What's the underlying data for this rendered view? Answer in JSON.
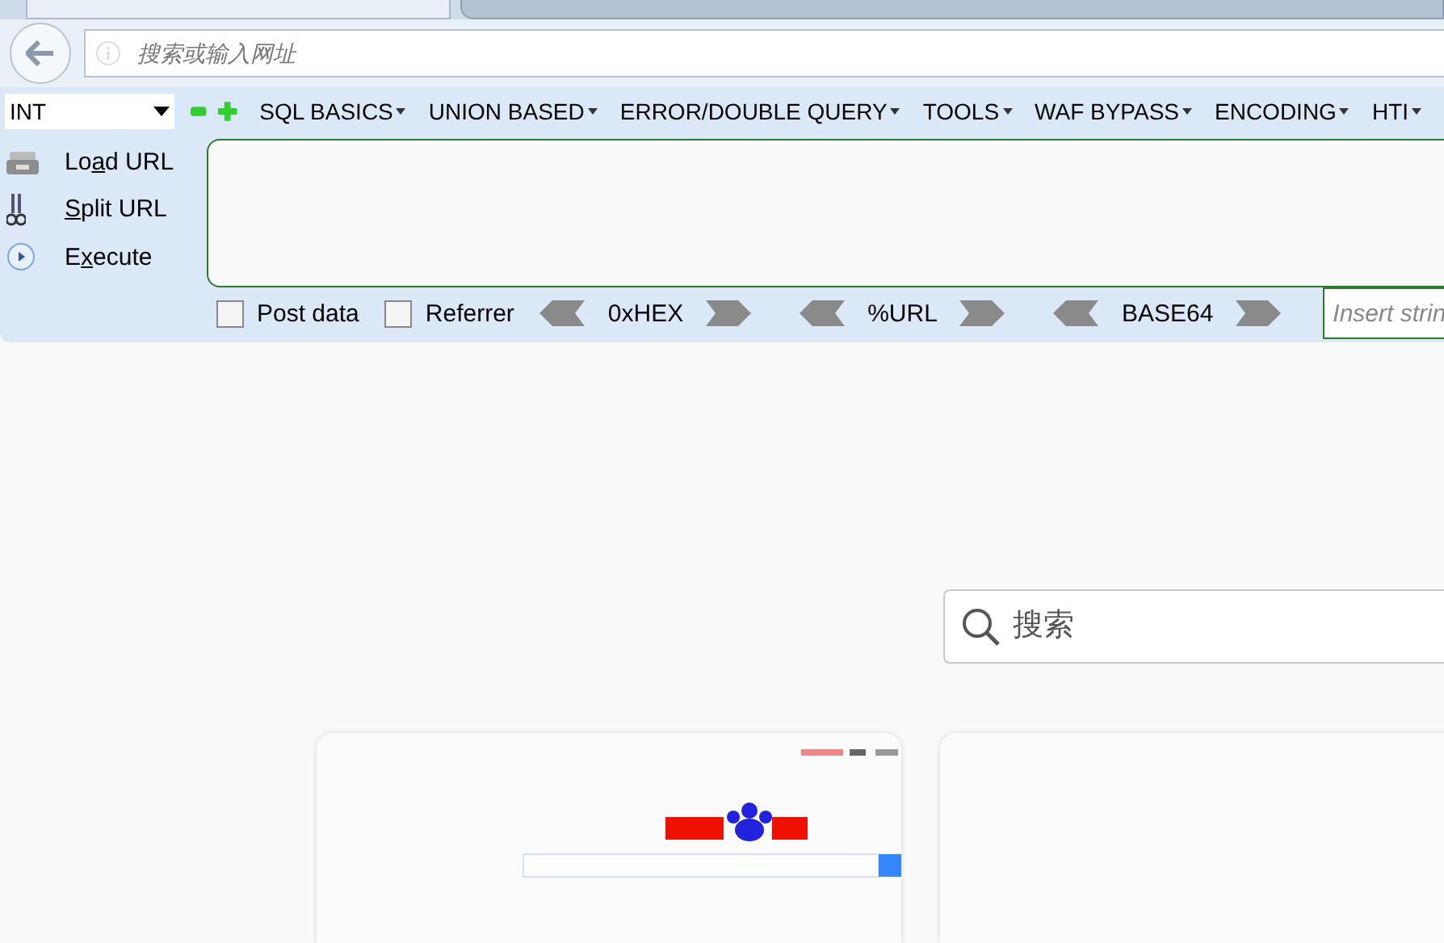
{
  "address_bar": {
    "placeholder": "搜索或输入网址"
  },
  "hackbar": {
    "select": {
      "value": "INT"
    },
    "menus": [
      {
        "label": "SQL BASICS"
      },
      {
        "label": "UNION BASED"
      },
      {
        "label": "ERROR/DOUBLE QUERY"
      },
      {
        "label": "TOOLS"
      },
      {
        "label": "WAF BYPASS"
      },
      {
        "label": "ENCODING"
      },
      {
        "label": "HTI"
      }
    ],
    "actions": [
      {
        "kind": "load",
        "pre": "Lo",
        "key": "a",
        "post": "d URL"
      },
      {
        "kind": "split",
        "key": "S",
        "post": "plit URL"
      },
      {
        "kind": "execute",
        "pre": "E",
        "key": "x",
        "post": "ecute"
      }
    ],
    "options": [
      {
        "label": "Post data",
        "checked": false
      },
      {
        "label": "Referrer",
        "checked": false
      }
    ],
    "encoders": [
      {
        "label": "0xHEX"
      },
      {
        "label": "%URL"
      },
      {
        "label": "BASE64"
      }
    ],
    "insert": {
      "placeholder": "Insert strin"
    }
  },
  "newtab": {
    "search": {
      "placeholder": "搜索"
    },
    "tiles": [
      {
        "kind": "picture"
      },
      {
        "kind": "blank"
      }
    ]
  }
}
